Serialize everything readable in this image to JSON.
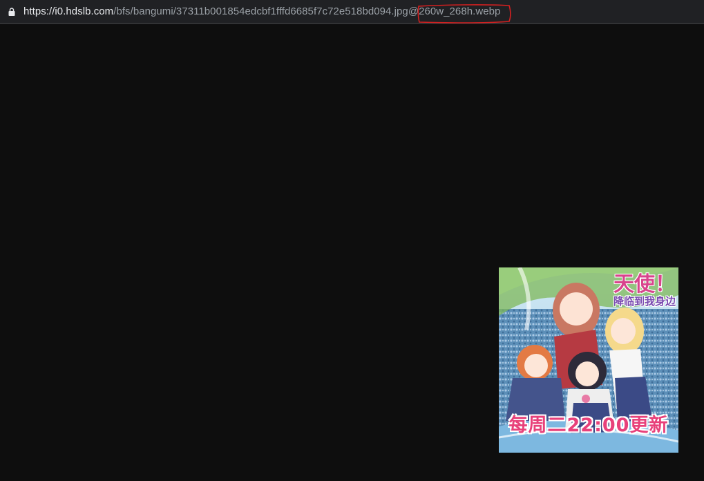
{
  "address_bar": {
    "url_host_prefix": "https://",
    "url_host": "i0.hdslb.com",
    "url_path": "/bfs/bangumi/37311b001854edcbf1fffd6685f7c72e518bd094.jpg",
    "url_suffix": "@260w_268h.webp",
    "lock_icon": "lock-icon",
    "annotation_color": "#d42020"
  },
  "viewer": {
    "background_color": "#0e0e0e",
    "image": {
      "title_line1": "天使！",
      "title_line2": "降临到我身边",
      "schedule_text": "每周二22:00更新"
    }
  }
}
